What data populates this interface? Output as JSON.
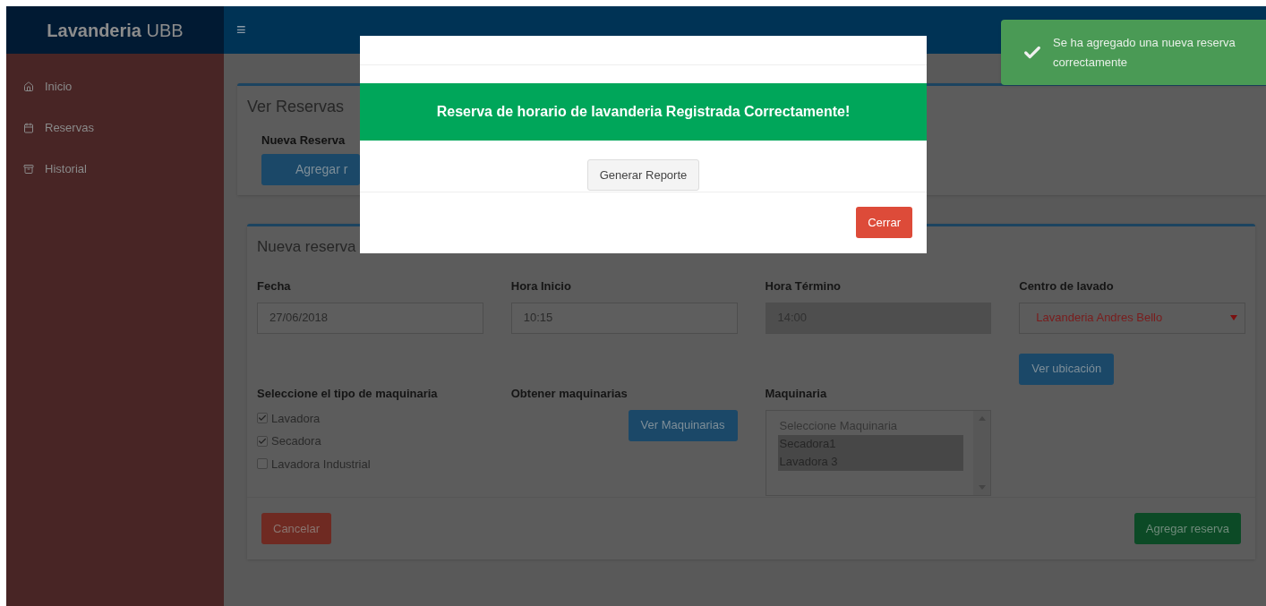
{
  "brand": "**Lavanderia** UBB",
  "menu_icon": "≡",
  "sidebar": {
    "items": [
      {
        "label": "Inicio"
      },
      {
        "label": "Reservas"
      },
      {
        "label": "Historial"
      }
    ]
  },
  "ver_reservas": {
    "title": "Ver Reservas",
    "label": "Nueva Reserva",
    "button": "Agregar r"
  },
  "form": {
    "title": "Nueva reserva",
    "fields": [
      {
        "label": "Fecha",
        "value": "27/06/2018",
        "disabled": false
      },
      {
        "label": "Hora Inicio",
        "value": "10:15",
        "disabled": false
      },
      {
        "label": "Hora Término",
        "value": "14:00",
        "disabled": true
      }
    ],
    "center": {
      "label": "Centro de lavado",
      "value": "Lavanderia Andres Bello",
      "button": "Ver ubicación"
    },
    "machine_types": {
      "label": "Seleccione el tipo de maquinaria",
      "options": [
        {
          "label": "Lavadora",
          "checked": true
        },
        {
          "label": "Secadora",
          "checked": true
        },
        {
          "label": "Lavadora Industrial",
          "checked": false
        }
      ]
    },
    "fetch": {
      "label": "Obtener maquinarias",
      "button": "Ver Maquinarias"
    },
    "machines": {
      "label": "Maquinaria",
      "options": [
        {
          "label": "Seleccione Maquinaria",
          "selected": false
        },
        {
          "label": "Secadora1",
          "selected": true
        },
        {
          "label": "Lavadora 3",
          "selected": true
        }
      ]
    },
    "cancel_button": "Cancelar",
    "submit_button": "Agregar reserva"
  },
  "modal": {
    "message": "Reserva de horario de lavanderia Registrada Correctamente!",
    "report_button": "Generar Reporte",
    "close_button": "Cerrar"
  },
  "toast": {
    "message": "Se ha agregado una nueva reserva correctamente"
  }
}
